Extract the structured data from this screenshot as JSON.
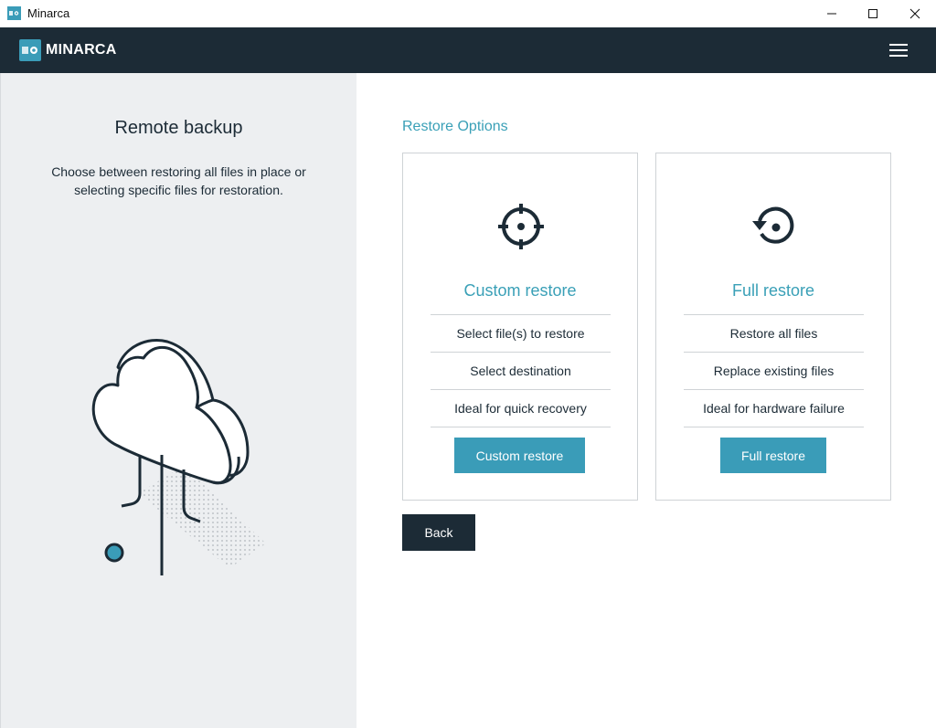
{
  "window": {
    "title": "Minarca",
    "icons": [
      "app-icon",
      "minimize-icon",
      "maximize-icon",
      "close-icon"
    ]
  },
  "header": {
    "brand": "MINARCA",
    "background": "#1c2b36",
    "menu_icon": "hamburger-menu-icon"
  },
  "left_panel": {
    "title": "Remote backup",
    "description": "Choose between restoring all files in place or selecting specific files for restoration.",
    "illustration": "cloud-network-illustration"
  },
  "main": {
    "section_title": "Restore Options",
    "accent_color": "#3aa0b7",
    "options": [
      {
        "icon": "crosshair-icon",
        "title": "Custom restore",
        "features": [
          "Select file(s) to restore",
          "Select destination",
          "Ideal for quick recovery"
        ],
        "button_label": "Custom restore"
      },
      {
        "icon": "history-restore-icon",
        "title": "Full restore",
        "features": [
          "Restore all files",
          "Replace existing files",
          "Ideal for hardware failure"
        ],
        "button_label": "Full restore"
      }
    ],
    "back_label": "Back"
  }
}
